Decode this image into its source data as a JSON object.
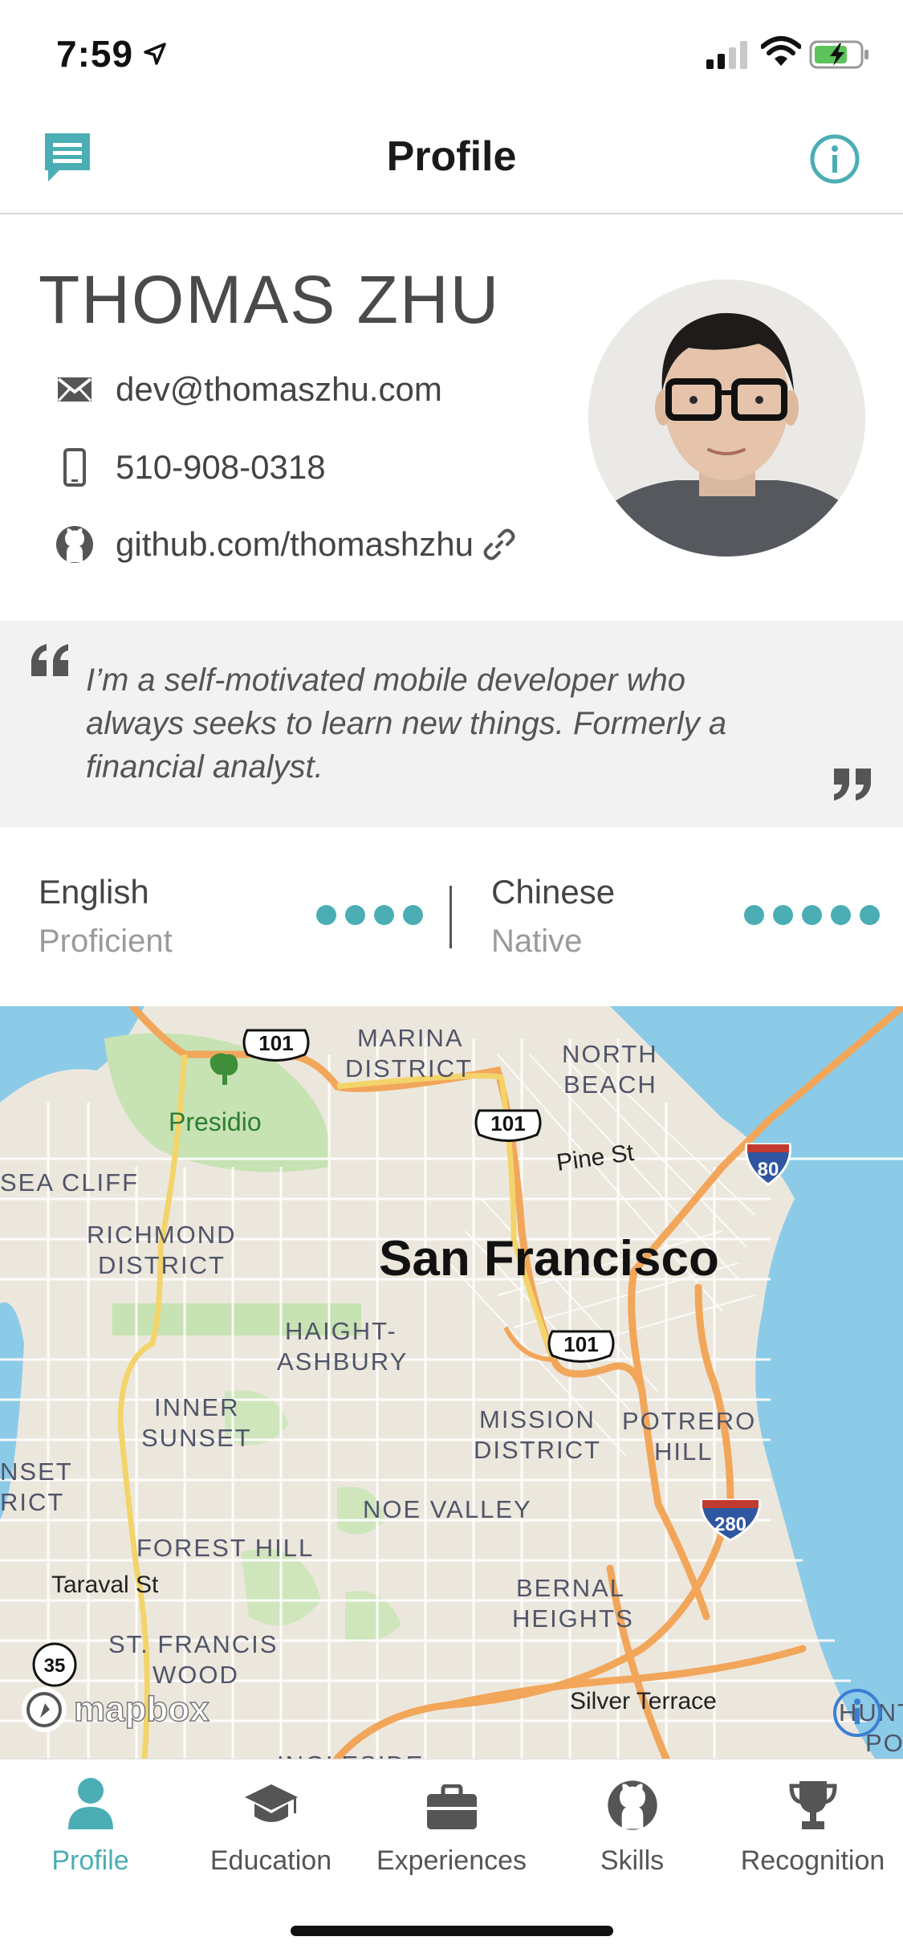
{
  "status_bar": {
    "time": "7:59"
  },
  "nav": {
    "title": "Profile",
    "chat_icon": "chat-bubble-icon",
    "info_icon": "info-icon"
  },
  "profile": {
    "name": "THOMAS ZHU",
    "email": "dev@thomaszhu.com",
    "phone": "510-908-0318",
    "github": "github.com/thomashzhu"
  },
  "quote": {
    "line1": "I’m a self-motivated mobile developer who",
    "line2": "always seeks to learn new things. Formerly a",
    "line3": "financial analyst."
  },
  "languages": [
    {
      "name": "English",
      "level": "Proficient",
      "dots": 4
    },
    {
      "name": "Chinese",
      "level": "Native",
      "dots": 5
    }
  ],
  "map": {
    "city": "San Francisco",
    "labels": {
      "marina": "MARINA",
      "marina2": "DISTRICT",
      "north_beach": "NORTH",
      "north_beach2": "BEACH",
      "presidio": "Presidio",
      "sea_cliff": "SEA CLIFF",
      "richmond": "RICHMOND",
      "richmond2": "DISTRICT",
      "pine": "Pine St",
      "haight": "HAIGHT-",
      "haight2": "ASHBURY",
      "inner_sunset": "INNER",
      "inner_sunset2": "SUNSET",
      "mission": "MISSION",
      "mission2": "DISTRICT",
      "potrero": "POTRERO",
      "potrero2": "HILL",
      "sunset": "NSET",
      "sunset2": "RICT",
      "noe": "NOE VALLEY",
      "forest_hill": "FOREST HILL",
      "taraval": "Taraval St",
      "st_francis": "ST. FRANCIS",
      "st_francis2": "WOOD",
      "bernal": "BERNAL",
      "bernal2": "HEIGHTS",
      "silver": "Silver Terrace",
      "hunters": "HUNTE",
      "hunters2": "POINT",
      "ingleside": "INGLESIDE"
    },
    "shields": {
      "us101": "101",
      "i80": "80",
      "i280": "280",
      "ca35": "35"
    },
    "attribution": "mapbox"
  },
  "tabs": [
    {
      "label": "Profile",
      "icon": "person-icon",
      "active": true
    },
    {
      "label": "Education",
      "icon": "graduation-cap-icon",
      "active": false
    },
    {
      "label": "Experiences",
      "icon": "briefcase-icon",
      "active": false
    },
    {
      "label": "Skills",
      "icon": "github-icon",
      "active": false
    },
    {
      "label": "Recognition",
      "icon": "trophy-icon",
      "active": false
    }
  ],
  "colors": {
    "accent": "#4aaeb4",
    "map_water": "#8ccbe8",
    "map_park": "#c7e2b3",
    "map_highway": "#f2a65a"
  }
}
